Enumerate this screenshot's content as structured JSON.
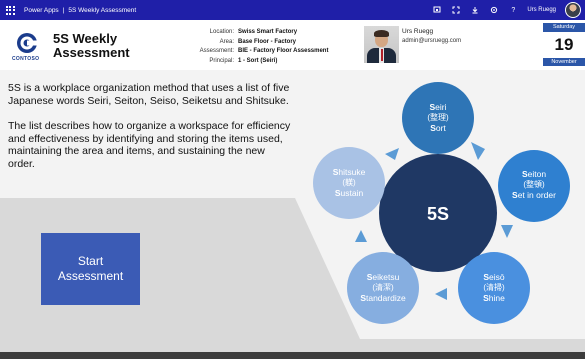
{
  "appbar": {
    "app_name": "Power Apps",
    "separator": "|",
    "screen_name": "5S Weekly Assessment",
    "user_name": "Urs Ruegg",
    "icons": [
      "waffle-icon",
      "sync-icon",
      "expand-icon",
      "download-icon",
      "settings-icon",
      "help-icon"
    ],
    "help_glyph": "?"
  },
  "header": {
    "logo_text": "CONTOSO",
    "title": "5S Weekly Assessment",
    "meta": {
      "location_label": "Location:",
      "location_value": "Swiss Smart Factory",
      "area_label": "Area:",
      "area_value": "Base Floor - Factory",
      "assessment_label": "Assessment:",
      "assessment_value": "BIE - Factory Floor Assessment",
      "principal_label": "Principal:",
      "principal_value": "1 - Sort (Seiri)"
    },
    "user": {
      "name": "Urs Ruegg",
      "email": "admin@ursruegg.com"
    },
    "date": {
      "weekday": "Saturday",
      "day": "19",
      "month": "November"
    }
  },
  "intro": {
    "paragraph1": "5S is a workplace organization method that uses a list of five Japanese words Seiri, Seiton, Seiso, Seiketsu and Shitsuke.",
    "paragraph2": "The list describes how to organize a workspace for efficiency and effectiveness by identifying and storing the items used, maintaining the area and items, and sustaining the new order."
  },
  "start_button": {
    "line1": "Start",
    "line2": "Assessment"
  },
  "diagram": {
    "center_label": "5S",
    "steps": [
      {
        "initial": "S",
        "rest": "eiri",
        "japanese": "(整理)",
        "en_initial": "S",
        "en_rest": "ort"
      },
      {
        "initial": "S",
        "rest": "eiton",
        "japanese": "(整頓)",
        "en_initial": "S",
        "en_rest": "et in order"
      },
      {
        "initial": "S",
        "rest": "eisō",
        "japanese": "(清掃)",
        "en_initial": "S",
        "en_rest": "hine"
      },
      {
        "initial": "S",
        "rest": "eiketsu",
        "japanese": "(清潔)",
        "en_initial": "S",
        "en_rest": "tandardize"
      },
      {
        "initial": "S",
        "rest": "hitsuke",
        "japanese": "(躾)",
        "en_initial": "S",
        "en_rest": "ustain"
      }
    ]
  },
  "colors": {
    "appbar": "#1F1FA8",
    "accent": "#2B56A8",
    "center_circle": "#1F3864",
    "step1": "#2E75B6",
    "step2": "#2F80D0",
    "step3": "#4A90DF",
    "step4": "#86AEE0",
    "step5": "#A9C2E5",
    "arrow": "#5B9BD5",
    "button": "#3B5BB5"
  }
}
